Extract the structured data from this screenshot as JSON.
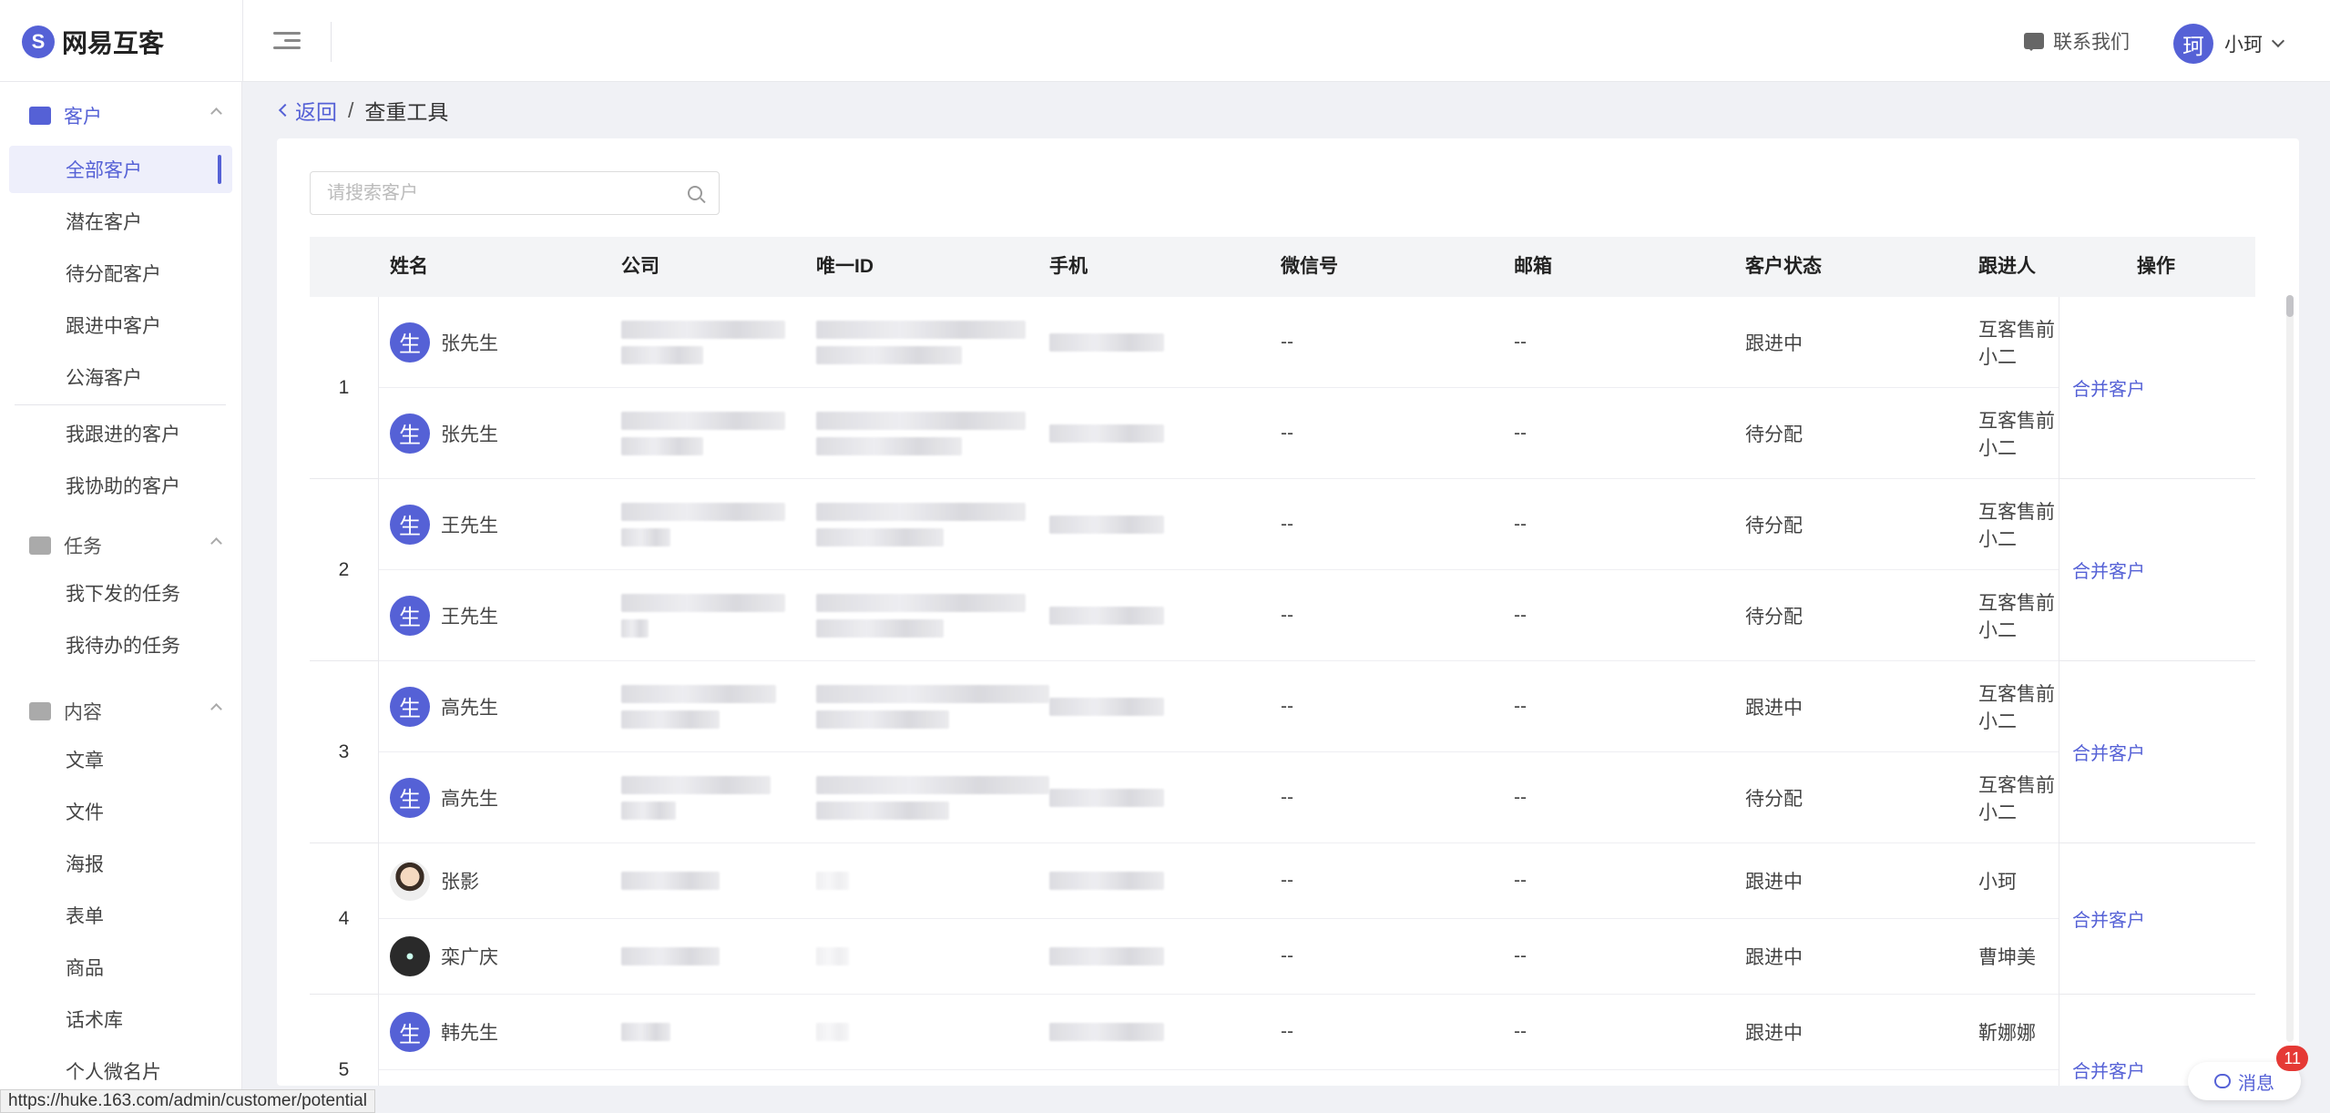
{
  "app": {
    "logo_mark": "S",
    "name": "网易互客"
  },
  "header": {
    "contact_label": "联系我们",
    "user_avatar_text": "珂",
    "user_name": "小珂"
  },
  "sidebar": {
    "customer_group": "客户",
    "customer_items": [
      "全部客户",
      "潜在客户",
      "待分配客户",
      "跟进中客户",
      "公海客户"
    ],
    "my_items": [
      "我跟进的客户",
      "我协助的客户"
    ],
    "task_group": "任务",
    "task_items": [
      "我下发的任务",
      "我待办的任务"
    ],
    "content_group": "内容",
    "content_items": [
      "文章",
      "文件",
      "海报",
      "表单",
      "商品",
      "话术库",
      "个人微名片"
    ]
  },
  "breadcrumb": {
    "back": "返回",
    "sep": "/",
    "current": "查重工具"
  },
  "search": {
    "placeholder": "请搜索客户"
  },
  "table": {
    "headers": [
      "姓名",
      "公司",
      "唯一ID",
      "手机",
      "微信号",
      "邮箱",
      "客户状态",
      "跟进人",
      "操作"
    ],
    "action_label": "合并客户",
    "groups": [
      {
        "index": "1",
        "rows": [
          {
            "avatar": "生",
            "name": "张先生",
            "wechat": "--",
            "email": "--",
            "status": "跟进中",
            "owner": "互客售前小二"
          },
          {
            "avatar": "生",
            "name": "张先生",
            "wechat": "--",
            "email": "--",
            "status": "待分配",
            "owner": "互客售前小二"
          }
        ]
      },
      {
        "index": "2",
        "rows": [
          {
            "avatar": "生",
            "name": "王先生",
            "wechat": "--",
            "email": "--",
            "status": "待分配",
            "owner": "互客售前小二"
          },
          {
            "avatar": "生",
            "name": "王先生",
            "wechat": "--",
            "email": "--",
            "status": "待分配",
            "owner": "互客售前小二"
          }
        ]
      },
      {
        "index": "3",
        "rows": [
          {
            "avatar": "生",
            "name": "高先生",
            "wechat": "--",
            "email": "--",
            "status": "跟进中",
            "owner": "互客售前小二"
          },
          {
            "avatar": "生",
            "name": "高先生",
            "wechat": "--",
            "email": "--",
            "status": "待分配",
            "owner": "互客售前小二"
          }
        ]
      },
      {
        "index": "4",
        "rows": [
          {
            "avatar": "",
            "name": "张影",
            "wechat": "--",
            "email": "--",
            "status": "跟进中",
            "owner": "小珂"
          },
          {
            "avatar": "",
            "name": "栾广庆",
            "wechat": "--",
            "email": "--",
            "status": "跟进中",
            "owner": "曹坤美"
          }
        ]
      },
      {
        "index": "5",
        "rows": [
          {
            "avatar": "生",
            "name": "韩先生",
            "wechat": "--",
            "email": "--",
            "status": "跟进中",
            "owner": "靳娜娜"
          }
        ]
      }
    ]
  },
  "statusbar": {
    "url": "https://huke.163.com/admin/customer/potential"
  },
  "messages": {
    "label": "消息",
    "count": "11"
  }
}
